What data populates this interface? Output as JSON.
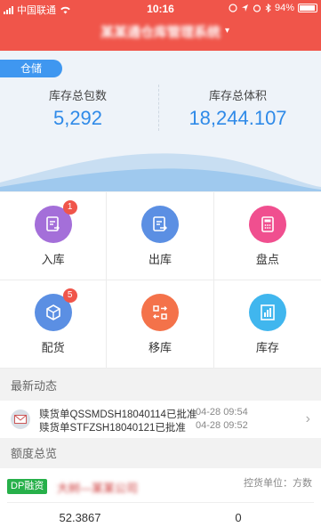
{
  "status_bar": {
    "carrier": "中国联通",
    "time": "10:16",
    "battery": "94%",
    "battery_level": 0.94
  },
  "header": {
    "title": "某某通仓库管理系统"
  },
  "summary": {
    "tag": "仓储",
    "stats": [
      {
        "label": "库存总包数",
        "value": "5,292"
      },
      {
        "label": "库存总体积",
        "value": "18,244.107"
      }
    ]
  },
  "grid": {
    "items": [
      {
        "label": "入库",
        "icon": "inbound-icon",
        "color": "#a46fd9",
        "badge": "1"
      },
      {
        "label": "出库",
        "icon": "outbound-icon",
        "color": "#5b8fe3",
        "badge": ""
      },
      {
        "label": "盘点",
        "icon": "calculator-icon",
        "color": "#f04f8f",
        "badge": ""
      },
      {
        "label": "配货",
        "icon": "box-icon",
        "color": "#5b8fe3",
        "badge": "5"
      },
      {
        "label": "移库",
        "icon": "transfer-icon",
        "color": "#f4724a",
        "badge": ""
      },
      {
        "label": "库存",
        "icon": "inventory-icon",
        "color": "#40b6ee",
        "badge": ""
      }
    ]
  },
  "news": {
    "heading": "最新动态",
    "lines": [
      {
        "text": "赎货单QSSMDSH18040114已批准",
        "time": "04-28 09:54"
      },
      {
        "text": "赎货单STFZSH18040121已批准",
        "time": "04-28 09:52"
      }
    ]
  },
  "quota": {
    "heading": "额度总览",
    "tag": "DP融资",
    "company": "大树—某某公司",
    "unit": "控货单位：方数",
    "values": [
      "52.3867",
      "0"
    ]
  }
}
